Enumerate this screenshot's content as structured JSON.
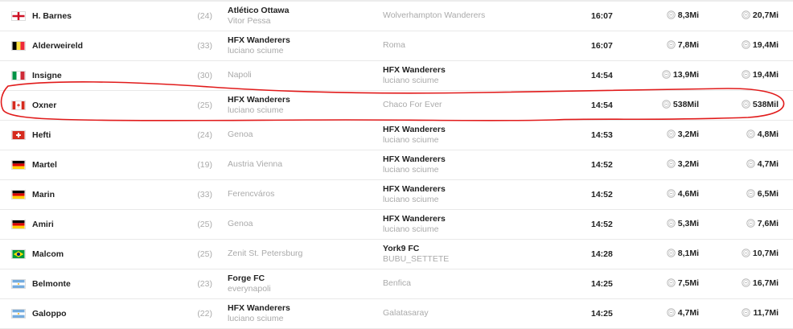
{
  "colors": {
    "annotation": "#e11b1b",
    "muted": "#aaaaaa",
    "text": "#222222",
    "divider": "#e9e9e9"
  },
  "icons": {
    "flag": "country-flag-icon",
    "value": "coin-icon"
  },
  "rows": [
    {
      "flag": "england",
      "name": "H. Barnes",
      "age": "(24)",
      "seller": {
        "club": "Atlético Ottawa",
        "manager": "Vitor Pessa",
        "mine": true
      },
      "buyer": {
        "club": "Wolverhampton Wanderers",
        "manager": "",
        "mine": false
      },
      "time": "16:07",
      "value1": "8,3Mi",
      "value2": "20,7Mi"
    },
    {
      "flag": "belgium",
      "name": "Alderweireld",
      "age": "(33)",
      "seller": {
        "club": "HFX Wanderers",
        "manager": "luciano sciume",
        "mine": true
      },
      "buyer": {
        "club": "Roma",
        "manager": "",
        "mine": false
      },
      "time": "16:07",
      "value1": "7,8Mi",
      "value2": "19,4Mi"
    },
    {
      "flag": "italy",
      "name": "Insigne",
      "age": "(30)",
      "seller": {
        "club": "Napoli",
        "manager": "",
        "mine": false
      },
      "buyer": {
        "club": "HFX Wanderers",
        "manager": "luciano sciume",
        "mine": true
      },
      "time": "14:54",
      "value1": "13,9Mi",
      "value2": "19,4Mi"
    },
    {
      "flag": "canada",
      "name": "Oxner",
      "age": "(25)",
      "seller": {
        "club": "HFX Wanderers",
        "manager": "luciano sciume",
        "mine": true
      },
      "buyer": {
        "club": "Chaco For Ever",
        "manager": "",
        "mine": false
      },
      "time": "14:54",
      "value1": "538Mil",
      "value2": "538Mil"
    },
    {
      "flag": "switzerland",
      "name": "Hefti",
      "age": "(24)",
      "seller": {
        "club": "Genoa",
        "manager": "",
        "mine": false
      },
      "buyer": {
        "club": "HFX Wanderers",
        "manager": "luciano sciume",
        "mine": true
      },
      "time": "14:53",
      "value1": "3,2Mi",
      "value2": "4,8Mi"
    },
    {
      "flag": "germany",
      "name": "Martel",
      "age": "(19)",
      "seller": {
        "club": "Austria Vienna",
        "manager": "",
        "mine": false
      },
      "buyer": {
        "club": "HFX Wanderers",
        "manager": "luciano sciume",
        "mine": true
      },
      "time": "14:52",
      "value1": "3,2Mi",
      "value2": "4,7Mi"
    },
    {
      "flag": "germany",
      "name": "Marin",
      "age": "(33)",
      "seller": {
        "club": "Ferencváros",
        "manager": "",
        "mine": false
      },
      "buyer": {
        "club": "HFX Wanderers",
        "manager": "luciano sciume",
        "mine": true
      },
      "time": "14:52",
      "value1": "4,6Mi",
      "value2": "6,5Mi"
    },
    {
      "flag": "germany",
      "name": "Amiri",
      "age": "(25)",
      "seller": {
        "club": "Genoa",
        "manager": "",
        "mine": false
      },
      "buyer": {
        "club": "HFX Wanderers",
        "manager": "luciano sciume",
        "mine": true
      },
      "time": "14:52",
      "value1": "5,3Mi",
      "value2": "7,6Mi"
    },
    {
      "flag": "brazil",
      "name": "Malcom",
      "age": "(25)",
      "seller": {
        "club": "Zenit St. Petersburg",
        "manager": "",
        "mine": false
      },
      "buyer": {
        "club": "York9 FC",
        "manager": "BUBU_SETTETE",
        "mine": true
      },
      "time": "14:28",
      "value1": "8,1Mi",
      "value2": "10,7Mi"
    },
    {
      "flag": "argentina",
      "name": "Belmonte",
      "age": "(23)",
      "seller": {
        "club": "Forge FC",
        "manager": "everynapoli",
        "mine": true
      },
      "buyer": {
        "club": "Benfica",
        "manager": "",
        "mine": false
      },
      "time": "14:25",
      "value1": "7,5Mi",
      "value2": "16,7Mi"
    },
    {
      "flag": "argentina",
      "name": "Galoppo",
      "age": "(22)",
      "seller": {
        "club": "HFX Wanderers",
        "manager": "luciano sciume",
        "mine": true
      },
      "buyer": {
        "club": "Galatasaray",
        "manager": "",
        "mine": false
      },
      "time": "14:25",
      "value1": "4,7Mi",
      "value2": "11,7Mi"
    }
  ]
}
